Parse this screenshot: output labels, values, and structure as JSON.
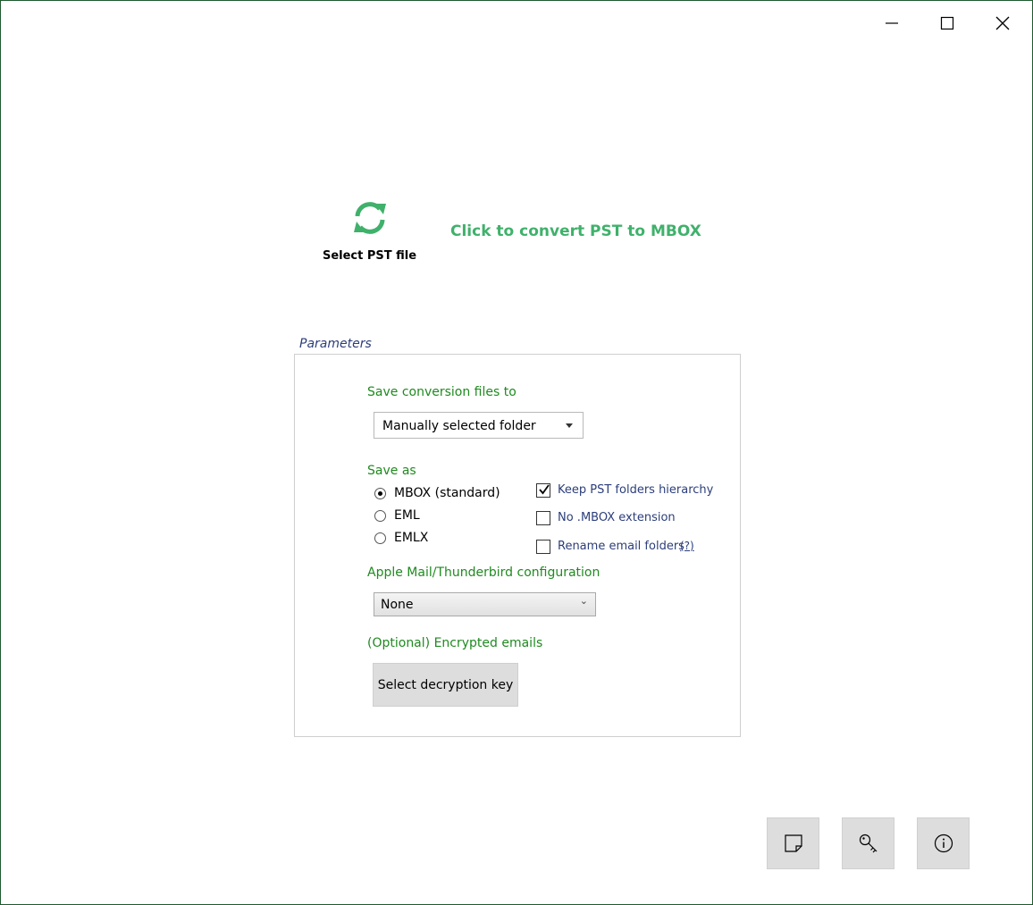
{
  "window_controls": {
    "minimize_icon": "minimize-icon",
    "maximize_icon": "maximize-icon",
    "close_icon": "close-icon"
  },
  "header": {
    "select_file_label": "Select PST file",
    "select_file_icon": "refresh-icon",
    "convert_link": "Click to convert PST to MBOX",
    "accent_color": "#3fb16b"
  },
  "parameters": {
    "legend": "Parameters",
    "save_to_label": "Save conversion files to",
    "save_to_value": "Manually selected folder",
    "save_as_label": "Save as",
    "formats": [
      {
        "label": "MBOX (standard)",
        "selected": true
      },
      {
        "label": "EML",
        "selected": false
      },
      {
        "label": "EMLX",
        "selected": false
      }
    ],
    "options": [
      {
        "label": "Keep PST folders hierarchy",
        "checked": true
      },
      {
        "label": "No .MBOX extension",
        "checked": false
      },
      {
        "label": "Rename email folders",
        "checked": false
      }
    ],
    "help_link": "(?)",
    "mail_config_label": "Apple Mail/Thunderbird configuration",
    "mail_config_value": "None",
    "encrypted_label": "(Optional) Encrypted emails",
    "decrypt_button": "Select decryption key"
  },
  "toolbar": {
    "buttons": [
      {
        "icon": "note-icon"
      },
      {
        "icon": "key-icon"
      },
      {
        "icon": "info-icon"
      }
    ]
  }
}
